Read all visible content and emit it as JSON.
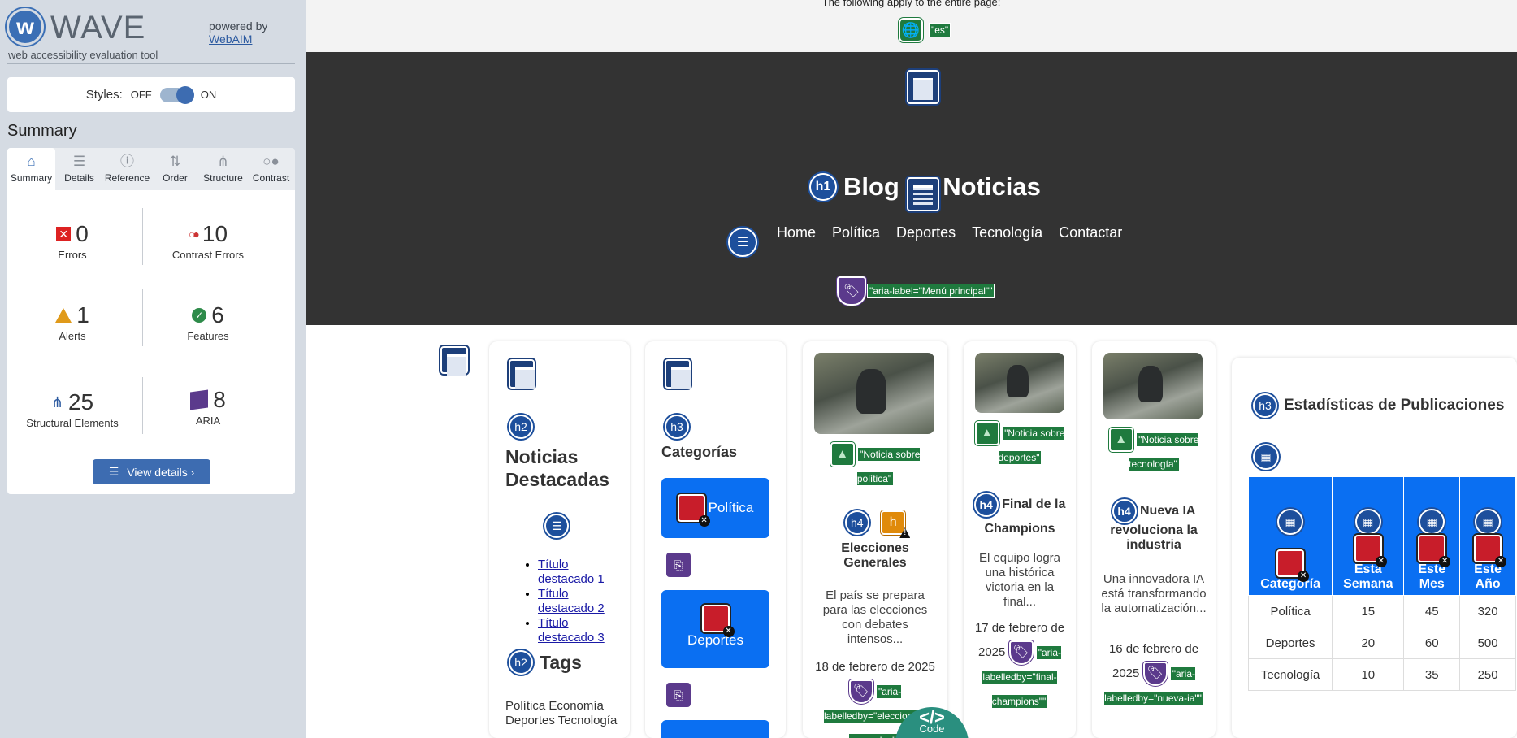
{
  "wave": {
    "title": "WAVE",
    "subtitle": "web accessibility evaluation tool",
    "powered_by": "powered by",
    "webaim": "WebAIM",
    "styles_label": "Styles:",
    "off": "OFF",
    "on": "ON",
    "summary_heading": "Summary",
    "tabs": [
      "Summary",
      "Details",
      "Reference",
      "Order",
      "Structure",
      "Contrast"
    ],
    "stats": {
      "errors": {
        "count": "0",
        "label": "Errors"
      },
      "contrast": {
        "count": "10",
        "label": "Contrast Errors"
      },
      "alerts": {
        "count": "1",
        "label": "Alerts"
      },
      "features": {
        "count": "6",
        "label": "Features"
      },
      "structural": {
        "count": "25",
        "label": "Structural Elements"
      },
      "aria": {
        "count": "8",
        "label": "ARIA"
      }
    },
    "view_details": "View details ›"
  },
  "page": {
    "top_note": "The following apply to the entire page:",
    "lang_tag": "\"es\"",
    "site_title": "Blog de Noticias",
    "h1": "h1",
    "nav": [
      "Home",
      "Política",
      "Deportes",
      "Tecnología",
      "Contactar"
    ],
    "nav_aria": "\"aria-label=\"Menú principal\"\"",
    "featured": {
      "h2": "h2",
      "title_line1": "Noticias",
      "title_line2": "Destacadas",
      "links": [
        "Título destacado 1",
        "Título destacado 2",
        "Título destacado 3"
      ],
      "tags_heading": "Tags",
      "tags_text": "Política Economía Deportes Tecnología"
    },
    "categories": {
      "h3": "h3",
      "title": "Categorías",
      "items": [
        "Política",
        "Deportes"
      ]
    },
    "news": [
      {
        "alt": "\"Noticia sobre política\"",
        "h4": "h4",
        "title": "Elecciones Generales",
        "text": "El país se prepara para las elecciones con debates intensos...",
        "date": "18 de febrero de 2025",
        "aria": "\"aria-labelledby=\"elecciones-generales\"\""
      },
      {
        "alt": "\"Noticia sobre deportes\"",
        "h4": "h4",
        "title": "Final de la Champions",
        "text": "El equipo logra una histórica victoria en la final...",
        "date": "17 de febrero de 2025",
        "aria": "\"aria-labelledby=\"final-champions\"\""
      },
      {
        "alt": "\"Noticia sobre tecnología\"",
        "h4": "h4",
        "title": "Nueva IA revoluciona la industria",
        "text": "Una innovadora IA está transformando la automatización...",
        "date": "16 de febrero de 2025",
        "aria": "\"aria-labelledby=\"nueva-ia\"\""
      }
    ],
    "stats_table": {
      "h3": "h3",
      "title": "Estadísticas de Publicaciones",
      "headers": [
        "Categoría",
        "Esta Semana",
        "Este Mes",
        "Este Año"
      ],
      "rows": [
        [
          "Política",
          "15",
          "45",
          "320"
        ],
        [
          "Deportes",
          "20",
          "60",
          "500"
        ],
        [
          "Tecnología",
          "10",
          "35",
          "250"
        ]
      ]
    },
    "code_button": "Code"
  }
}
